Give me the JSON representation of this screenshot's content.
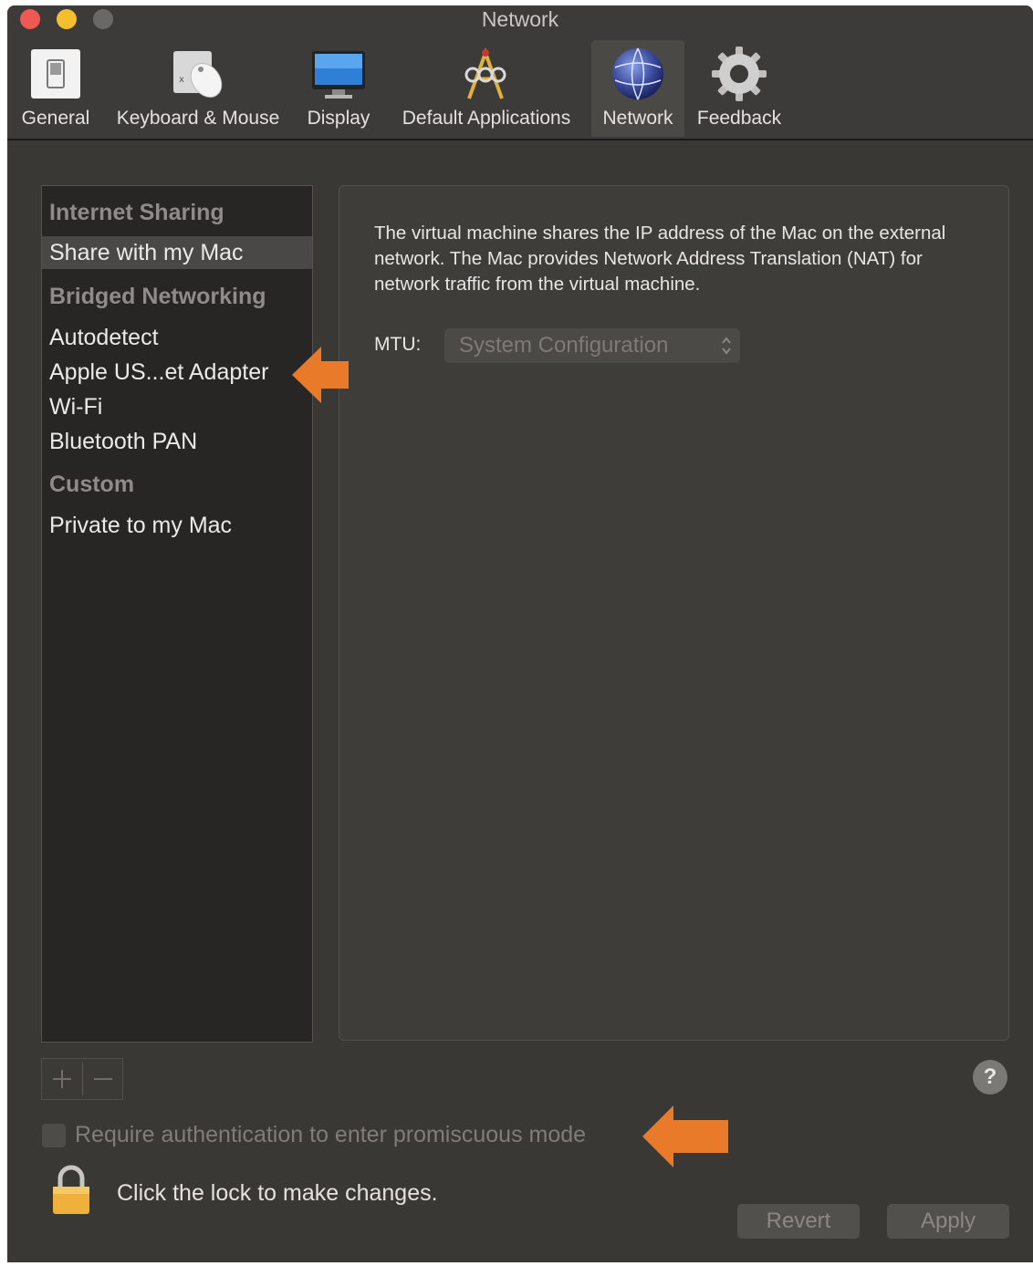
{
  "window": {
    "title": "Network"
  },
  "toolbar": {
    "items": [
      {
        "label": "General",
        "icon": "general-switch-icon"
      },
      {
        "label": "Keyboard & Mouse",
        "icon": "keyboard-mouse-icon"
      },
      {
        "label": "Display",
        "icon": "display-monitor-icon"
      },
      {
        "label": "Default Applications",
        "icon": "default-applications-icon"
      },
      {
        "label": "Network",
        "icon": "network-globe-icon",
        "active": true
      },
      {
        "label": "Feedback",
        "icon": "feedback-gear-icon"
      }
    ]
  },
  "sidebar": {
    "sections": [
      {
        "header": "Internet Sharing",
        "items": [
          {
            "label": "Share with my Mac",
            "selected": true
          }
        ]
      },
      {
        "header": "Bridged Networking",
        "items": [
          {
            "label": "Autodetect"
          },
          {
            "label": "Apple US...et Adapter"
          },
          {
            "label": "Wi-Fi"
          },
          {
            "label": "Bluetooth PAN"
          }
        ]
      },
      {
        "header": "Custom",
        "items": [
          {
            "label": "Private to my Mac"
          }
        ]
      }
    ],
    "add_label": "+",
    "remove_label": "−"
  },
  "panel": {
    "description": "The virtual machine shares the IP address of the Mac on the external network. The Mac provides Network Address Translation (NAT) for network traffic from the virtual machine.",
    "mtu_label": "MTU:",
    "mtu_value": "System Configuration"
  },
  "help_label": "?",
  "promiscuous_checkbox": {
    "label": "Require authentication to enter promiscuous mode",
    "checked": false
  },
  "lock": {
    "text": "Click the lock to make changes."
  },
  "buttons": {
    "revert": "Revert",
    "apply": "Apply"
  },
  "colors": {
    "annotation_arrow": "#e87a2a",
    "window_bg": "#3a3835"
  }
}
